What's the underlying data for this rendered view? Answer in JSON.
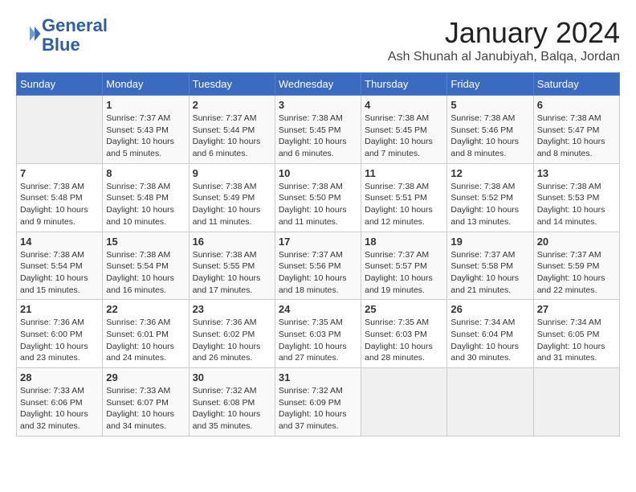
{
  "header": {
    "logo_line1": "General",
    "logo_line2": "Blue",
    "month": "January 2024",
    "location": "Ash Shunah al Janubiyah, Balqa, Jordan"
  },
  "weekdays": [
    "Sunday",
    "Monday",
    "Tuesday",
    "Wednesday",
    "Thursday",
    "Friday",
    "Saturday"
  ],
  "weeks": [
    [
      {
        "day": "",
        "info": ""
      },
      {
        "day": "1",
        "info": "Sunrise: 7:37 AM\nSunset: 5:43 PM\nDaylight: 10 hours\nand 5 minutes."
      },
      {
        "day": "2",
        "info": "Sunrise: 7:37 AM\nSunset: 5:44 PM\nDaylight: 10 hours\nand 6 minutes."
      },
      {
        "day": "3",
        "info": "Sunrise: 7:38 AM\nSunset: 5:45 PM\nDaylight: 10 hours\nand 6 minutes."
      },
      {
        "day": "4",
        "info": "Sunrise: 7:38 AM\nSunset: 5:45 PM\nDaylight: 10 hours\nand 7 minutes."
      },
      {
        "day": "5",
        "info": "Sunrise: 7:38 AM\nSunset: 5:46 PM\nDaylight: 10 hours\nand 8 minutes."
      },
      {
        "day": "6",
        "info": "Sunrise: 7:38 AM\nSunset: 5:47 PM\nDaylight: 10 hours\nand 8 minutes."
      }
    ],
    [
      {
        "day": "7",
        "info": "Sunrise: 7:38 AM\nSunset: 5:48 PM\nDaylight: 10 hours\nand 9 minutes."
      },
      {
        "day": "8",
        "info": "Sunrise: 7:38 AM\nSunset: 5:48 PM\nDaylight: 10 hours\nand 10 minutes."
      },
      {
        "day": "9",
        "info": "Sunrise: 7:38 AM\nSunset: 5:49 PM\nDaylight: 10 hours\nand 11 minutes."
      },
      {
        "day": "10",
        "info": "Sunrise: 7:38 AM\nSunset: 5:50 PM\nDaylight: 10 hours\nand 11 minutes."
      },
      {
        "day": "11",
        "info": "Sunrise: 7:38 AM\nSunset: 5:51 PM\nDaylight: 10 hours\nand 12 minutes."
      },
      {
        "day": "12",
        "info": "Sunrise: 7:38 AM\nSunset: 5:52 PM\nDaylight: 10 hours\nand 13 minutes."
      },
      {
        "day": "13",
        "info": "Sunrise: 7:38 AM\nSunset: 5:53 PM\nDaylight: 10 hours\nand 14 minutes."
      }
    ],
    [
      {
        "day": "14",
        "info": "Sunrise: 7:38 AM\nSunset: 5:54 PM\nDaylight: 10 hours\nand 15 minutes."
      },
      {
        "day": "15",
        "info": "Sunrise: 7:38 AM\nSunset: 5:54 PM\nDaylight: 10 hours\nand 16 minutes."
      },
      {
        "day": "16",
        "info": "Sunrise: 7:38 AM\nSunset: 5:55 PM\nDaylight: 10 hours\nand 17 minutes."
      },
      {
        "day": "17",
        "info": "Sunrise: 7:37 AM\nSunset: 5:56 PM\nDaylight: 10 hours\nand 18 minutes."
      },
      {
        "day": "18",
        "info": "Sunrise: 7:37 AM\nSunset: 5:57 PM\nDaylight: 10 hours\nand 19 minutes."
      },
      {
        "day": "19",
        "info": "Sunrise: 7:37 AM\nSunset: 5:58 PM\nDaylight: 10 hours\nand 21 minutes."
      },
      {
        "day": "20",
        "info": "Sunrise: 7:37 AM\nSunset: 5:59 PM\nDaylight: 10 hours\nand 22 minutes."
      }
    ],
    [
      {
        "day": "21",
        "info": "Sunrise: 7:36 AM\nSunset: 6:00 PM\nDaylight: 10 hours\nand 23 minutes."
      },
      {
        "day": "22",
        "info": "Sunrise: 7:36 AM\nSunset: 6:01 PM\nDaylight: 10 hours\nand 24 minutes."
      },
      {
        "day": "23",
        "info": "Sunrise: 7:36 AM\nSunset: 6:02 PM\nDaylight: 10 hours\nand 26 minutes."
      },
      {
        "day": "24",
        "info": "Sunrise: 7:35 AM\nSunset: 6:03 PM\nDaylight: 10 hours\nand 27 minutes."
      },
      {
        "day": "25",
        "info": "Sunrise: 7:35 AM\nSunset: 6:03 PM\nDaylight: 10 hours\nand 28 minutes."
      },
      {
        "day": "26",
        "info": "Sunrise: 7:34 AM\nSunset: 6:04 PM\nDaylight: 10 hours\nand 30 minutes."
      },
      {
        "day": "27",
        "info": "Sunrise: 7:34 AM\nSunset: 6:05 PM\nDaylight: 10 hours\nand 31 minutes."
      }
    ],
    [
      {
        "day": "28",
        "info": "Sunrise: 7:33 AM\nSunset: 6:06 PM\nDaylight: 10 hours\nand 32 minutes."
      },
      {
        "day": "29",
        "info": "Sunrise: 7:33 AM\nSunset: 6:07 PM\nDaylight: 10 hours\nand 34 minutes."
      },
      {
        "day": "30",
        "info": "Sunrise: 7:32 AM\nSunset: 6:08 PM\nDaylight: 10 hours\nand 35 minutes."
      },
      {
        "day": "31",
        "info": "Sunrise: 7:32 AM\nSunset: 6:09 PM\nDaylight: 10 hours\nand 37 minutes."
      },
      {
        "day": "",
        "info": ""
      },
      {
        "day": "",
        "info": ""
      },
      {
        "day": "",
        "info": ""
      }
    ]
  ]
}
